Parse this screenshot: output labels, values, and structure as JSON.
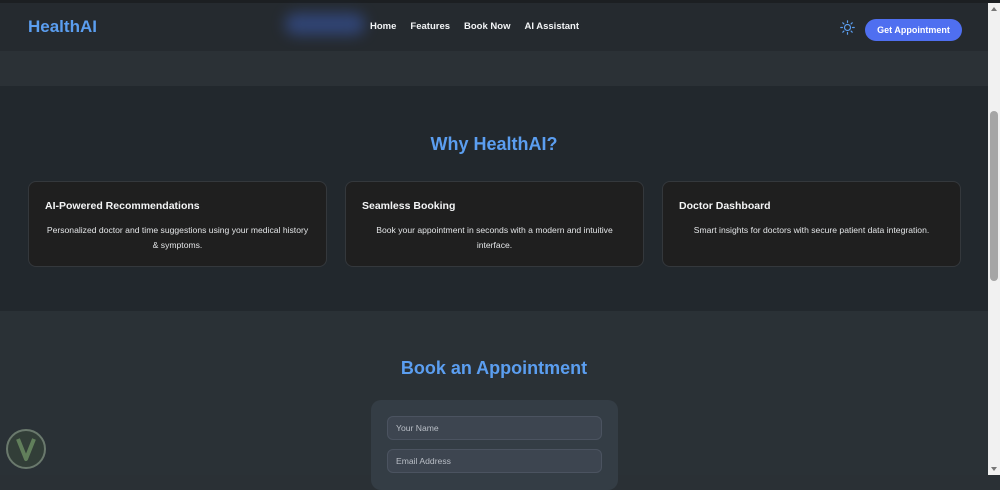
{
  "header": {
    "brand": "HealthAI",
    "nav": [
      "Home",
      "Features",
      "Book Now",
      "AI Assistant"
    ],
    "theme_icon": "sun-icon",
    "cta_label": "Get Appointment"
  },
  "why": {
    "title": "Why HealthAI?",
    "cards": [
      {
        "title": "AI-Powered Recommendations",
        "desc": "Personalized doctor and time suggestions using your medical history & symptoms."
      },
      {
        "title": "Seamless Booking",
        "desc": "Book your appointment in seconds with a modern and intuitive interface."
      },
      {
        "title": "Doctor Dashboard",
        "desc": "Smart insights for doctors with secure patient data integration."
      }
    ]
  },
  "book": {
    "title": "Book an Appointment",
    "name_placeholder": "Your Name",
    "email_placeholder": "Email Address"
  },
  "colors": {
    "accent": "#5b9ef0",
    "button": "#4f6ff0",
    "card_bg": "#1f1f1f"
  }
}
